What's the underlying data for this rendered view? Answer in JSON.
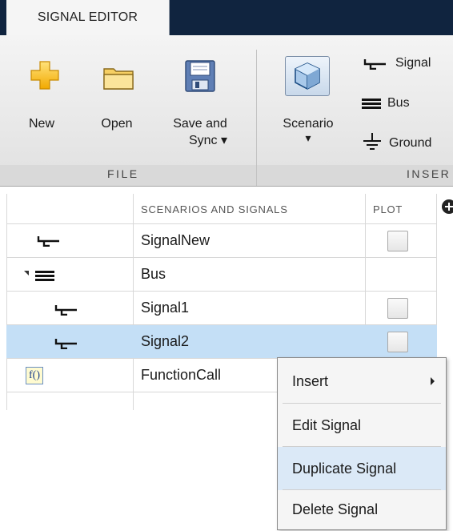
{
  "tab": {
    "label": "SIGNAL EDITOR"
  },
  "ribbon": {
    "new_label": "New",
    "open_label": "Open",
    "save_label_line1": "Save and",
    "save_label_line2": "Sync ▾",
    "scenario_label": "Scenario",
    "scenario_arrow": "▾",
    "signal_label": "Signal",
    "bus_label": "Bus",
    "ground_label": "Ground",
    "file_section": "FILE",
    "insert_section": "INSER"
  },
  "table": {
    "col_scenarios": "SCENARIOS AND SIGNALS",
    "col_plot": "PLOT",
    "rows": [
      {
        "name": "SignalNew",
        "icon": "signal-icon",
        "has_checkbox": true
      },
      {
        "name": "Bus",
        "icon": "bus-icon",
        "has_checkbox": false
      },
      {
        "name": "Signal1",
        "icon": "signal-icon",
        "has_checkbox": true
      },
      {
        "name": "Signal2",
        "icon": "signal-icon",
        "has_checkbox": true,
        "selected": true
      },
      {
        "name": "FunctionCall",
        "icon": "function-call-icon",
        "has_checkbox": false
      }
    ],
    "function_icon_text": "f()"
  },
  "context_menu": {
    "items": [
      "Insert",
      "Edit Signal",
      "Duplicate Signal",
      "Delete Signal"
    ],
    "hovered": "Duplicate Signal"
  },
  "colors": {
    "title_bar": "#10243f",
    "selection": "#c4dff6",
    "menu_hover": "#dbe9f7"
  }
}
